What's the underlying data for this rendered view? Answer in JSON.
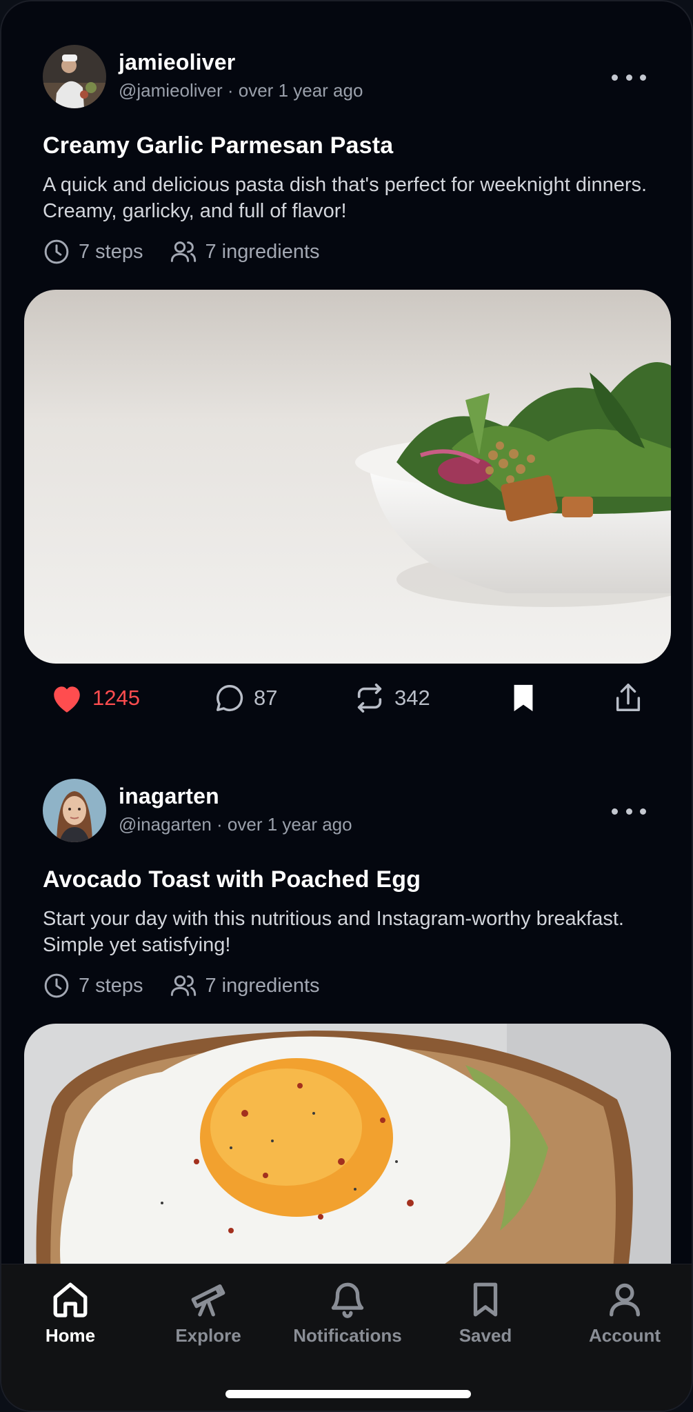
{
  "posts": [
    {
      "username": "jamieoliver",
      "meta": "@jamieoliver · over 1 year ago",
      "title": "Creamy Garlic Parmesan Pasta",
      "description": "A quick and delicious pasta dish that's perfect for weeknight dinners. Creamy, garlicky, and full of flavor!",
      "steps": "7 steps",
      "ingredients": "7 ingredients",
      "likes": "1245",
      "comments": "87",
      "reposts": "342",
      "liked": true,
      "saved": true
    },
    {
      "username": "inagarten",
      "meta": "@inagarten · over 1 year ago",
      "title": "Avocado Toast with Poached Egg",
      "description": "Start your day with this nutritious and Instagram-worthy breakfast. Simple yet satisfying!",
      "steps": "7 steps",
      "ingredients": "7 ingredients"
    }
  ],
  "tabbar": {
    "items": [
      {
        "label": "Home",
        "icon": "home-icon",
        "active": true
      },
      {
        "label": "Explore",
        "icon": "telescope-icon",
        "active": false
      },
      {
        "label": "Notifications",
        "icon": "bell-icon",
        "active": false
      },
      {
        "label": "Saved",
        "icon": "bookmark-icon",
        "active": false
      },
      {
        "label": "Account",
        "icon": "user-icon",
        "active": false
      }
    ]
  },
  "colors": {
    "background": "#04070f",
    "accent_like": "#ff4d4f",
    "text_muted": "#9aa0ab",
    "tabbar": "#111214"
  }
}
